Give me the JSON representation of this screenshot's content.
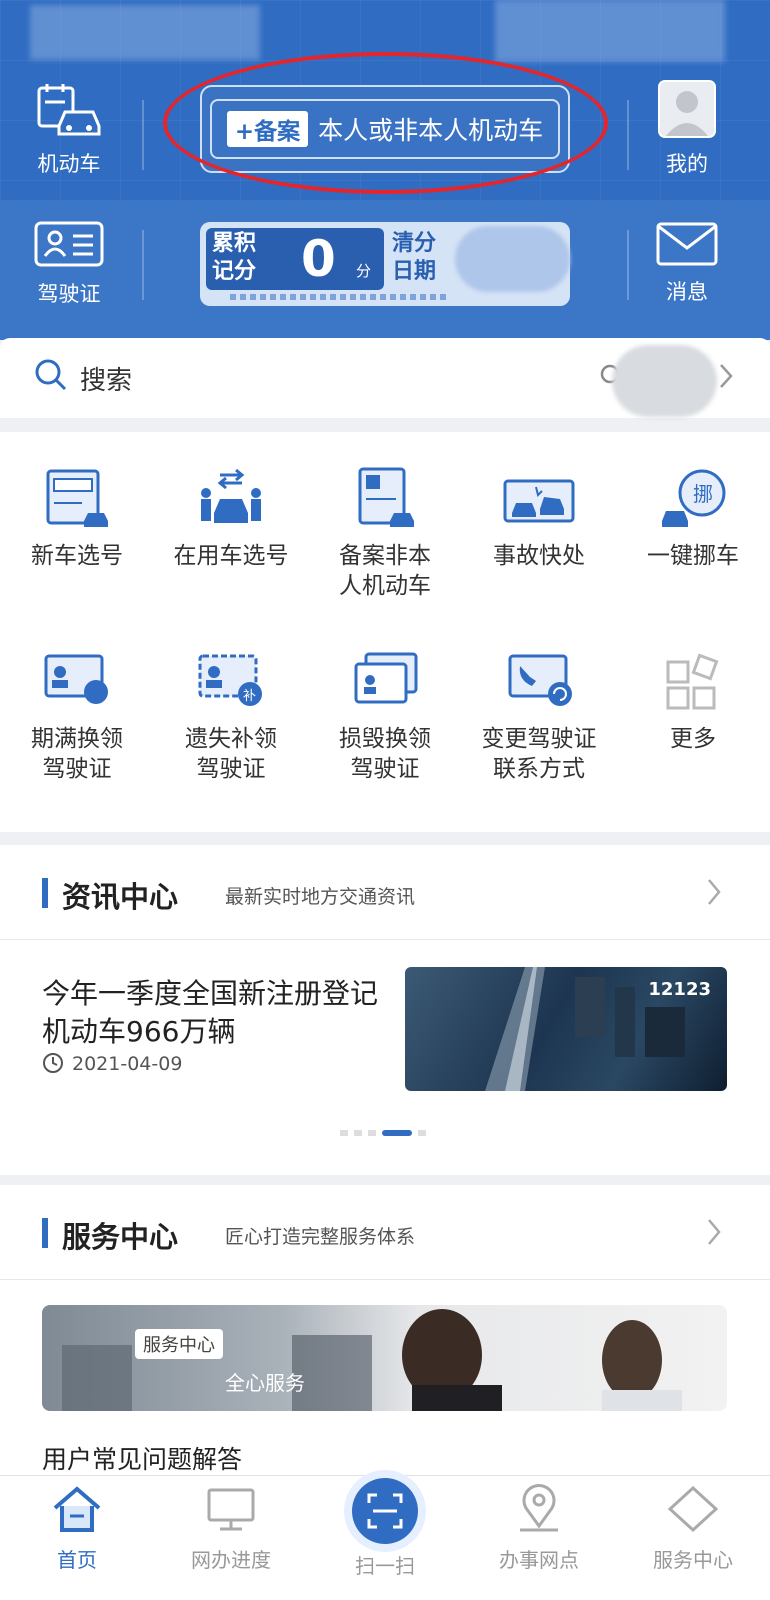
{
  "header": {
    "motor_vehicle_label": "机动车",
    "license_label": "驾驶证",
    "mine_label": "我的",
    "message_label": "消息",
    "plate_tag": "+备案",
    "plate_text": "本人或非本人机动车",
    "score_label": "累积记分",
    "score_value": "0",
    "score_unit": "分",
    "clear_date_label": "清分日期"
  },
  "search": {
    "placeholder": "搜索"
  },
  "services": [
    {
      "label": "新车选号",
      "icon": "new-car-plate-icon"
    },
    {
      "label": "在用车选号",
      "icon": "in-use-car-plate-icon"
    },
    {
      "label": "备案非本\n人机动车",
      "icon": "register-vehicle-icon"
    },
    {
      "label": "事故快处",
      "icon": "accident-icon"
    },
    {
      "label": "一键挪车",
      "icon": "move-car-icon"
    },
    {
      "label": "期满换领\n驾驶证",
      "icon": "license-renew-icon"
    },
    {
      "label": "遗失补领\n驾驶证",
      "icon": "license-reissue-icon"
    },
    {
      "label": "损毁换领\n驾驶证",
      "icon": "license-replace-icon"
    },
    {
      "label": "变更驾驶证\n联系方式",
      "icon": "change-contact-icon"
    },
    {
      "label": "更多",
      "icon": "more-icon"
    }
  ],
  "news": {
    "section_title": "资讯中心",
    "section_sub": "最新实时地方交通资讯",
    "headline": "今年一季度全国新注册登记机动车966万辆",
    "date": "2021-04-09",
    "image_brand": "12123"
  },
  "service_center": {
    "section_title": "服务中心",
    "section_sub": "匠心打造完整服务体系",
    "banner_tag": "服务中心",
    "banner_slogan": "全心服务",
    "faq_label": "用户常见问题解答"
  },
  "tabbar": {
    "items": [
      {
        "label": "首页",
        "active": true
      },
      {
        "label": "网办进度",
        "active": false
      },
      {
        "label": "扫一扫",
        "active": false
      },
      {
        "label": "办事网点",
        "active": false
      },
      {
        "label": "服务中心",
        "active": false
      }
    ]
  },
  "colors": {
    "primary": "#2f6cc2",
    "annotation_red": "#e4262c"
  }
}
